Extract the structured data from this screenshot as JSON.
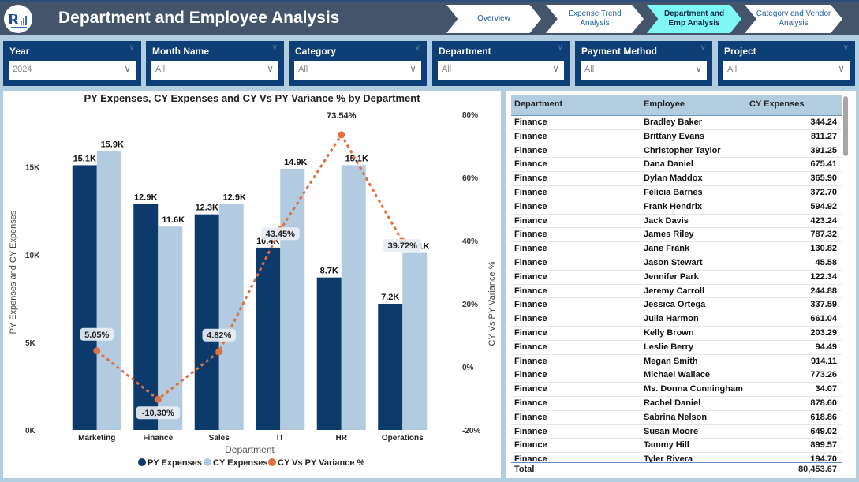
{
  "header": {
    "title": "Department and Employee Analysis",
    "nav": [
      {
        "label": "Overview",
        "active": false
      },
      {
        "label": "Expense Trend Analysis",
        "active": false
      },
      {
        "label": "Department and Emp Analysis",
        "active": true
      },
      {
        "label": "Category and Vendor Analysis",
        "active": false
      }
    ]
  },
  "slicers": [
    {
      "label": "Year",
      "value": "2024"
    },
    {
      "label": "Month Name",
      "value": "All"
    },
    {
      "label": "Category",
      "value": "All"
    },
    {
      "label": "Department",
      "value": "All"
    },
    {
      "label": "Payment Method",
      "value": "All"
    },
    {
      "label": "Project",
      "value": "All"
    }
  ],
  "colors": {
    "py": "#0b3a6b",
    "cy": "#b3cbe0",
    "variance": "#e07040",
    "header_bg": "#44546a",
    "slicer_bg": "#0e3e76",
    "active_nav": "#7ff7f7"
  },
  "chart_data": {
    "type": "bar",
    "title": "PY Expenses, CY Expenses and CY Vs PY Variance % by Department",
    "xlabel": "Department",
    "ylabel": "PY Expenses and CY Expenses",
    "y2label": "CY Vs PY Variance %",
    "categories": [
      "Marketing",
      "Finance",
      "Sales",
      "IT",
      "HR",
      "Operations"
    ],
    "series": [
      {
        "name": "PY Expenses",
        "type": "bar",
        "values": [
          15100,
          12900,
          12300,
          10400,
          8700,
          7200
        ],
        "labels": [
          "15.1K",
          "12.9K",
          "12.3K",
          "10.4K",
          "8.7K",
          "7.2K"
        ]
      },
      {
        "name": "CY Expenses",
        "type": "bar",
        "values": [
          15900,
          11600,
          12900,
          14900,
          15100,
          10100
        ],
        "labels": [
          "15.9K",
          "11.6K",
          "12.9K",
          "14.9K",
          "15.1K",
          "10.1K"
        ]
      },
      {
        "name": "CY Vs PY Variance %",
        "type": "line",
        "axis": "secondary",
        "values": [
          5.05,
          -10.3,
          4.82,
          43.45,
          73.54,
          39.72
        ],
        "labels": [
          "5.05%",
          "-10.30%",
          "4.82%",
          "43.45%",
          "73.54%",
          "39.72%"
        ]
      }
    ],
    "ylim": [
      0,
      18000
    ],
    "yticks": [
      {
        "v": 0,
        "label": "0K"
      },
      {
        "v": 5000,
        "label": "5K"
      },
      {
        "v": 10000,
        "label": "10K"
      },
      {
        "v": 15000,
        "label": "15K"
      }
    ],
    "y2lim": [
      -20,
      80
    ],
    "y2ticks": [
      {
        "v": -20,
        "label": "-20%"
      },
      {
        "v": 0,
        "label": "0%"
      },
      {
        "v": 20,
        "label": "20%"
      },
      {
        "v": 40,
        "label": "40%"
      },
      {
        "v": 60,
        "label": "60%"
      },
      {
        "v": 80,
        "label": "80%"
      }
    ],
    "legend": "bottom-center",
    "grid": false
  },
  "table": {
    "columns": [
      "Department",
      "Employee",
      "CY Expenses"
    ],
    "rows": [
      [
        "Finance",
        "Bradley Baker",
        "344.24"
      ],
      [
        "Finance",
        "Brittany Evans",
        "811.27"
      ],
      [
        "Finance",
        "Christopher Taylor",
        "391.25"
      ],
      [
        "Finance",
        "Dana Daniel",
        "675.41"
      ],
      [
        "Finance",
        "Dylan Maddox",
        "365.90"
      ],
      [
        "Finance",
        "Felicia Barnes",
        "372.70"
      ],
      [
        "Finance",
        "Frank Hendrix",
        "594.92"
      ],
      [
        "Finance",
        "Jack Davis",
        "423.24"
      ],
      [
        "Finance",
        "James Riley",
        "787.32"
      ],
      [
        "Finance",
        "Jane Frank",
        "130.82"
      ],
      [
        "Finance",
        "Jason Stewart",
        "45.58"
      ],
      [
        "Finance",
        "Jennifer Park",
        "122.34"
      ],
      [
        "Finance",
        "Jeremy Carroll",
        "244.88"
      ],
      [
        "Finance",
        "Jessica Ortega",
        "337.59"
      ],
      [
        "Finance",
        "Julia Harmon",
        "661.04"
      ],
      [
        "Finance",
        "Kelly Brown",
        "203.29"
      ],
      [
        "Finance",
        "Leslie Berry",
        "94.49"
      ],
      [
        "Finance",
        "Megan Smith",
        "914.11"
      ],
      [
        "Finance",
        "Michael Wallace",
        "773.26"
      ],
      [
        "Finance",
        "Ms. Donna Cunningham",
        "34.07"
      ],
      [
        "Finance",
        "Rachel Daniel",
        "878.60"
      ],
      [
        "Finance",
        "Sabrina Nelson",
        "618.86"
      ],
      [
        "Finance",
        "Susan Moore",
        "649.02"
      ],
      [
        "Finance",
        "Tammy Hill",
        "899.57"
      ],
      [
        "Finance",
        "Tyler Rivera",
        "194.70"
      ]
    ],
    "total_label": "Total",
    "total_value": "80,453.67"
  }
}
